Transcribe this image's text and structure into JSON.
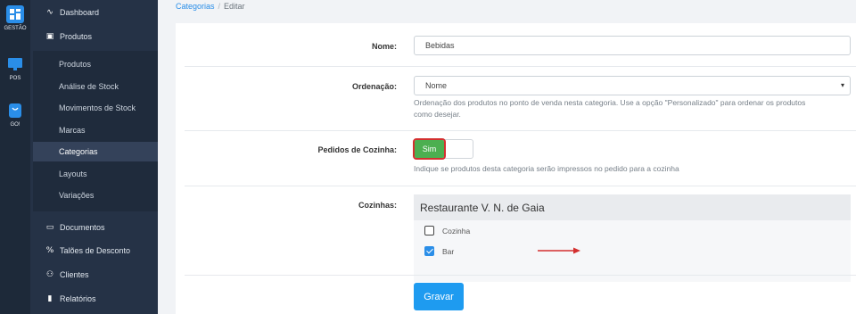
{
  "rail": [
    {
      "label": "GESTÃO",
      "icon": "dashboard-grid-icon",
      "color": "#2a8ee8"
    },
    {
      "label": "POS",
      "icon": "monitor-icon",
      "color": "#2a8ee8"
    },
    {
      "label": "GO!",
      "icon": "shopping-bag-icon",
      "color": "#2a8ee8"
    }
  ],
  "sidebar": {
    "dashboard": {
      "label": "Dashboard",
      "icon": "activity-icon"
    },
    "produtos": {
      "label": "Produtos",
      "icon": "box-icon"
    },
    "sub": [
      {
        "label": "Produtos"
      },
      {
        "label": "Análise de Stock"
      },
      {
        "label": "Movimentos de Stock"
      },
      {
        "label": "Marcas"
      },
      {
        "label": "Categorias",
        "active": true
      },
      {
        "label": "Layouts"
      },
      {
        "label": "Variações"
      }
    ],
    "documentos": {
      "label": "Documentos",
      "icon": "folder-icon"
    },
    "taloes": {
      "label": "Talões de Desconto",
      "icon": "percent-icon"
    },
    "clientes": {
      "label": "Clientes",
      "icon": "users-icon"
    },
    "relatorios": {
      "label": "Relatórios",
      "icon": "bar-chart-icon"
    }
  },
  "breadcrumb": {
    "link": "Categorias",
    "sep": "/",
    "current": "Editar"
  },
  "form": {
    "nome": {
      "label": "Nome:",
      "value": "Bebidas"
    },
    "ordenacao": {
      "label": "Ordenação:",
      "value": "Nome",
      "help_line1": "Ordenação dos produtos no ponto de venda nesta categoria. Use a opção \"Personalizado\" para ordenar os produtos",
      "help_line2": "como desejar."
    },
    "pedidos": {
      "label": "Pedidos de Cozinha:",
      "toggle_on": "Sim",
      "help": "Indique se produtos desta categoria serão impressos no pedido para a cozinha"
    },
    "cozinhas": {
      "label": "Cozinhas:",
      "group": "Restaurante V. N. de Gaia",
      "options": [
        {
          "label": "Cozinha",
          "checked": false
        },
        {
          "label": "Bar",
          "checked": true
        }
      ]
    },
    "save_label": "Gravar"
  },
  "colors": {
    "accent": "#1e9bf0",
    "toggle_on": "#4caf50",
    "highlight": "#d32f2f"
  }
}
